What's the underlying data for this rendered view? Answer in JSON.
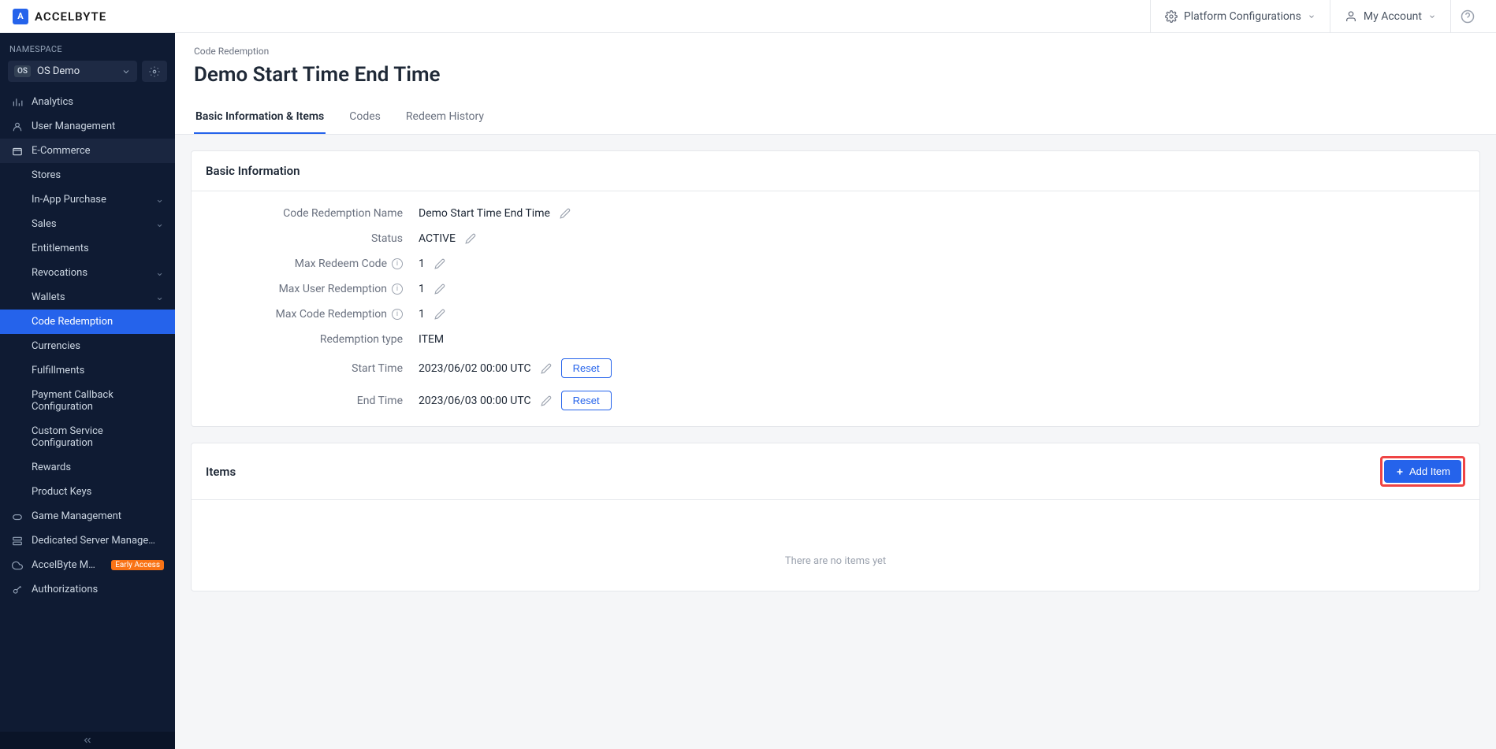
{
  "header": {
    "brand": "ACCELBYTE",
    "platform_config": "Platform Configurations",
    "my_account": "My Account"
  },
  "sidebar": {
    "ns_label": "NAMESPACE",
    "ns_badge": "OS",
    "ns_name": "OS Demo",
    "items": [
      {
        "label": "Analytics"
      },
      {
        "label": "User Management"
      },
      {
        "label": "E-Commerce"
      }
    ],
    "ecommerce_children": [
      {
        "label": "Stores"
      },
      {
        "label": "In-App Purchase",
        "caret": true
      },
      {
        "label": "Sales",
        "caret": true
      },
      {
        "label": "Entitlements"
      },
      {
        "label": "Revocations",
        "caret": true
      },
      {
        "label": "Wallets",
        "caret": true
      },
      {
        "label": "Code Redemption",
        "active": true
      },
      {
        "label": "Currencies"
      },
      {
        "label": "Fulfillments"
      },
      {
        "label": "Payment Callback Configuration"
      },
      {
        "label": "Custom Service Configuration"
      },
      {
        "label": "Rewards"
      },
      {
        "label": "Product Keys"
      }
    ],
    "tail": [
      {
        "label": "Game Management"
      },
      {
        "label": "Dedicated Server Management"
      },
      {
        "label": "AccelByte Multiplaye...",
        "badge": "Early Access"
      },
      {
        "label": "Authorizations"
      }
    ]
  },
  "main": {
    "breadcrumb": "Code Redemption",
    "title": "Demo Start Time End Time",
    "tabs": [
      {
        "label": "Basic Information & Items",
        "active": true
      },
      {
        "label": "Codes"
      },
      {
        "label": "Redeem History"
      }
    ],
    "basic_info": {
      "heading": "Basic Information",
      "rows": {
        "name_label": "Code Redemption Name",
        "name_value": "Demo Start Time End Time",
        "status_label": "Status",
        "status_value": "ACTIVE",
        "max_redeem_label": "Max Redeem Code",
        "max_redeem_value": "1",
        "max_user_label": "Max User Redemption",
        "max_user_value": "1",
        "max_code_label": "Max Code Redemption",
        "max_code_value": "1",
        "type_label": "Redemption type",
        "type_value": "ITEM",
        "start_label": "Start Time",
        "start_value": "2023/06/02 00:00 UTC",
        "end_label": "End Time",
        "end_value": "2023/06/03 00:00 UTC",
        "reset": "Reset"
      }
    },
    "items": {
      "heading": "Items",
      "add_button": "Add Item",
      "empty": "There are no items yet"
    }
  }
}
